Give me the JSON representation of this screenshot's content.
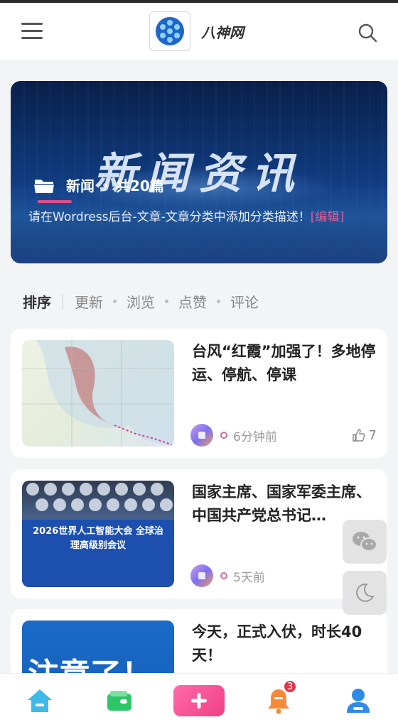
{
  "header": {
    "site_name": "八神网"
  },
  "banner": {
    "title": "新闻资讯",
    "category": "新闻",
    "count": "共20篇",
    "description": "请在Wordress后台-文章-文章分类中添加分类描述！",
    "edit_label": "[编辑]"
  },
  "sort": {
    "title": "排序",
    "options": [
      "更新",
      "浏览",
      "点赞",
      "评论"
    ]
  },
  "posts": [
    {
      "title": "台风“红霞”加强了！多地停运、停航、停课",
      "time": "6分钟前",
      "likes": "7",
      "thumb_text": ""
    },
    {
      "title": "国家主席、国家军委主席、中国共产党总书记…",
      "time": "5天前",
      "likes": "",
      "thumb_text": "2026世界人工智能大会 全球治理高级别会议"
    },
    {
      "title": "今天，正式入伏，时长40天！",
      "time": "",
      "likes": "",
      "thumb_text": "注意了！"
    }
  ],
  "tabbar": {
    "notification_count": "3"
  },
  "colors": {
    "accent": "#f03f86",
    "banner_bg": "#0e3776",
    "badge": "#e8334a"
  }
}
